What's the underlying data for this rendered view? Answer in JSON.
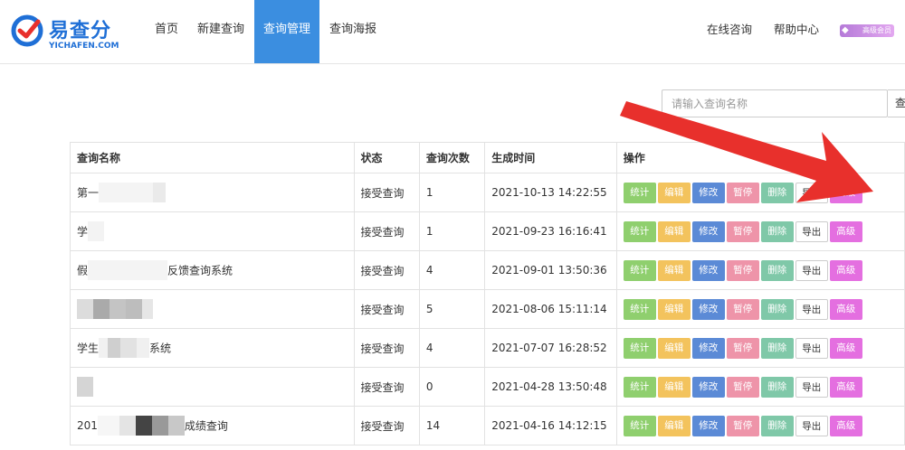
{
  "logo": {
    "name": "易查分",
    "sub": "YICHAFEN.COM"
  },
  "nav": {
    "items": [
      {
        "label": "首页"
      },
      {
        "label": "新建查询"
      },
      {
        "label": "查询管理"
      },
      {
        "label": "查询海报"
      }
    ],
    "active_index": 2,
    "right": {
      "consult": "在线咨询",
      "help": "帮助中心",
      "vip": "高级会员"
    }
  },
  "search": {
    "placeholder": "请输入查询名称",
    "button": "查"
  },
  "table": {
    "headers": [
      "查询名称",
      "状态",
      "查询次数",
      "生成时间",
      "操作"
    ],
    "actions": [
      "统计",
      "编辑",
      "修改",
      "暂停",
      "删除",
      "导出",
      "高级"
    ],
    "rows": [
      {
        "name_prefix": "第一",
        "name_suffix": "",
        "status": "接受查询",
        "count": "1",
        "time": "2021-10-13 14:22:55"
      },
      {
        "name_prefix": "学",
        "name_suffix": "",
        "status": "接受查询",
        "count": "1",
        "time": "2021-09-23 16:16:41"
      },
      {
        "name_prefix": "假",
        "name_suffix": "反馈查询系统",
        "status": "接受查询",
        "count": "4",
        "time": "2021-09-01 13:50:36"
      },
      {
        "name_prefix": "",
        "name_suffix": "",
        "status": "接受查询",
        "count": "5",
        "time": "2021-08-06 15:11:14"
      },
      {
        "name_prefix": "学生",
        "name_suffix": "系统",
        "status": "接受查询",
        "count": "4",
        "time": "2021-07-07 16:28:52"
      },
      {
        "name_prefix": "",
        "name_suffix": "",
        "status": "接受查询",
        "count": "0",
        "time": "2021-04-28 13:50:48"
      },
      {
        "name_prefix": "201",
        "name_suffix": "成绩查询",
        "status": "接受查询",
        "count": "14",
        "time": "2021-04-16 14:12:15"
      }
    ]
  },
  "colors": {
    "accent": "#3b8ee0",
    "arrow": "#e8302c",
    "brand": "#1f6fd6"
  }
}
